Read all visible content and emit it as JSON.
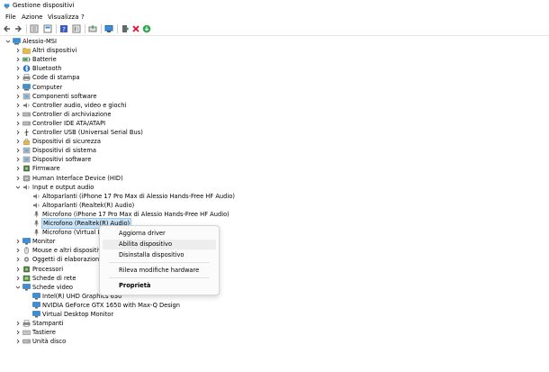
{
  "window": {
    "title": "Gestione dispositivi"
  },
  "menu": [
    "File",
    "Azione",
    "Visualizza",
    "?"
  ],
  "toolbar": {
    "icons": [
      "back-icon",
      "forward-icon",
      "properties-list-icon",
      "properties-icon",
      "help-icon",
      "details-icon",
      "update-driver-icon",
      "monitor-icon",
      "add-driver-icon",
      "uninstall-icon",
      "enable-icon"
    ]
  },
  "colors": {
    "selection": "#cce4f7",
    "remove": "#e81123",
    "enable": "#2fa84f",
    "folder": "#e8b84a",
    "monitor": "#3b8ed8"
  },
  "tree": {
    "root": "Alessio-MSI",
    "categories": [
      "Altri dispositivi",
      "Batterie",
      "Bluetooth",
      "Code di stampa",
      "Computer",
      "Componenti software",
      "Controller audio, video e giochi",
      "Controller di archiviazione",
      "Controller IDE ATA/ATAPI",
      "Controller USB (Universal Serial Bus)",
      "Dispositivi di sicurezza",
      "Dispositivi di sistema",
      "Dispositivi software",
      "Firmware",
      "Human Interface Device (HID)",
      "Input e output audio"
    ],
    "audio_children": [
      "Altoparlanti (iPhone 17 Pro Max di Alessio Hands-Free HF Audio)",
      "Altoparlanti (Realtek(R) Audio)",
      "Microfono (iPhone 17 Pro Max di Alessio Hands-Free HF Audio)",
      "Microfono (Realtek(R) Audio)",
      "Microfono (Virtual Desktop Audio)"
    ],
    "categories_after": [
      "Monitor",
      "Mouse e altri dispositivi di puntamento",
      "Oggetti di elaborazione audio (APO)",
      "Processori",
      "Schede di rete",
      "Schede video"
    ],
    "video_children": [
      "Intel(R) UHD Graphics 630",
      "NVIDIA GeForce GTX 1650 with Max-Q Design",
      "Virtual Desktop Monitor"
    ],
    "categories_end": [
      "Stampanti",
      "Tastiere",
      "Unità disco"
    ]
  },
  "context_menu": {
    "items": [
      "Aggiorna driver",
      "Abilita dispositivo",
      "Disinstalla dispositivo",
      "Rileva modifiche hardware",
      "Proprietà"
    ],
    "hover_index": 1,
    "bold_index": 4
  }
}
